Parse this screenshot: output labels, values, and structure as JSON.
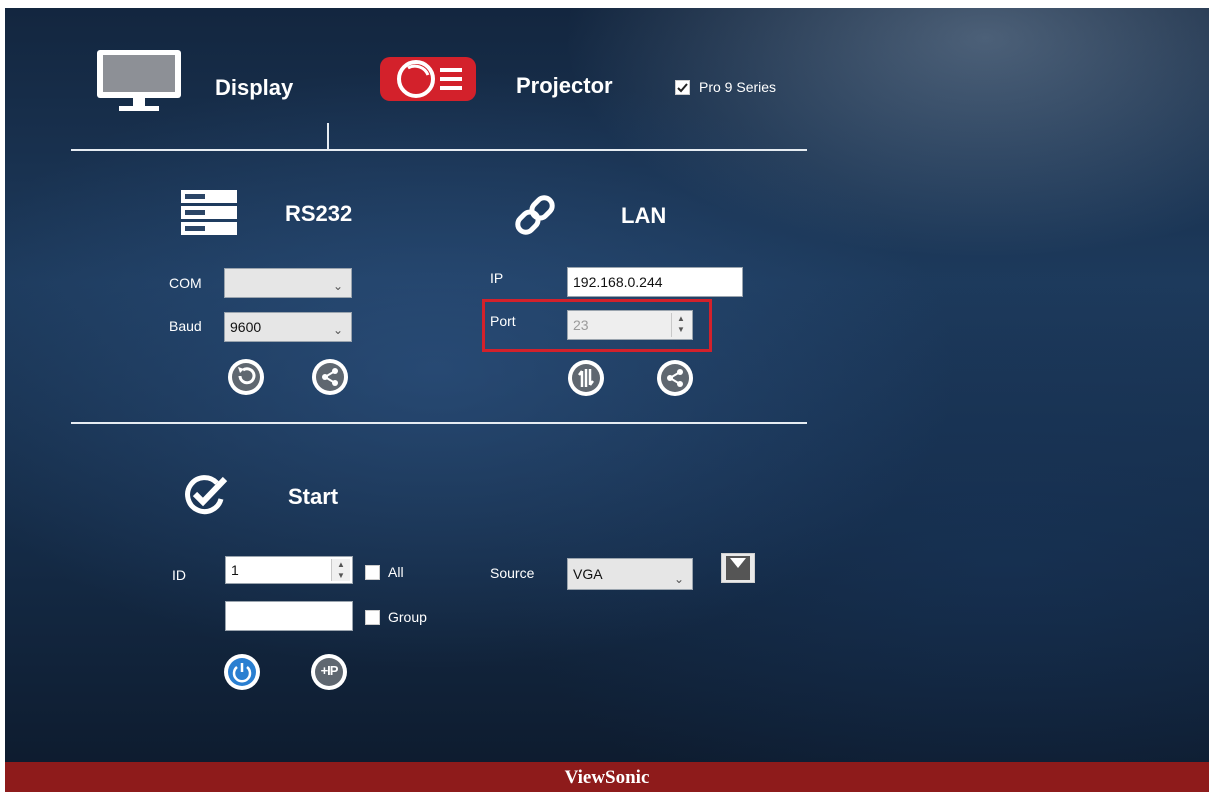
{
  "header": {
    "display_label": "Display",
    "projector_label": "Projector",
    "pro9_checkbox_label": "Pro 9 Series",
    "pro9_checked": true
  },
  "rs232": {
    "title": "RS232",
    "com_label": "COM",
    "com_value": "",
    "baud_label": "Baud",
    "baud_value": "9600"
  },
  "lan": {
    "title": "LAN",
    "ip_label": "IP",
    "ip_value": "192.168.0.244",
    "port_label": "Port",
    "port_value": "23"
  },
  "start": {
    "title": "Start",
    "id_label": "ID",
    "id_value": "1",
    "all_label": "All",
    "all_checked": false,
    "group_value": "",
    "group_label": "Group",
    "group_checked": false,
    "source_label": "Source",
    "source_value": "VGA",
    "ip_button_label": "+IP"
  },
  "footer": {
    "brand": "ViewSonic"
  },
  "colors": {
    "highlight": "#d3212b",
    "footer_bg": "#8e1b1b",
    "projector_red": "#d3212b",
    "power_blue": "#2a7fd1"
  },
  "icons": {
    "display": "monitor-icon",
    "projector": "projector-icon",
    "rs232": "server-stack-icon",
    "lan": "link-icon",
    "start": "check-circle-icon",
    "refresh": "refresh-icon",
    "share": "share-icon",
    "ping": "network-ping-icon",
    "power": "power-icon",
    "source_apply": "dropdown-arrow-icon"
  }
}
